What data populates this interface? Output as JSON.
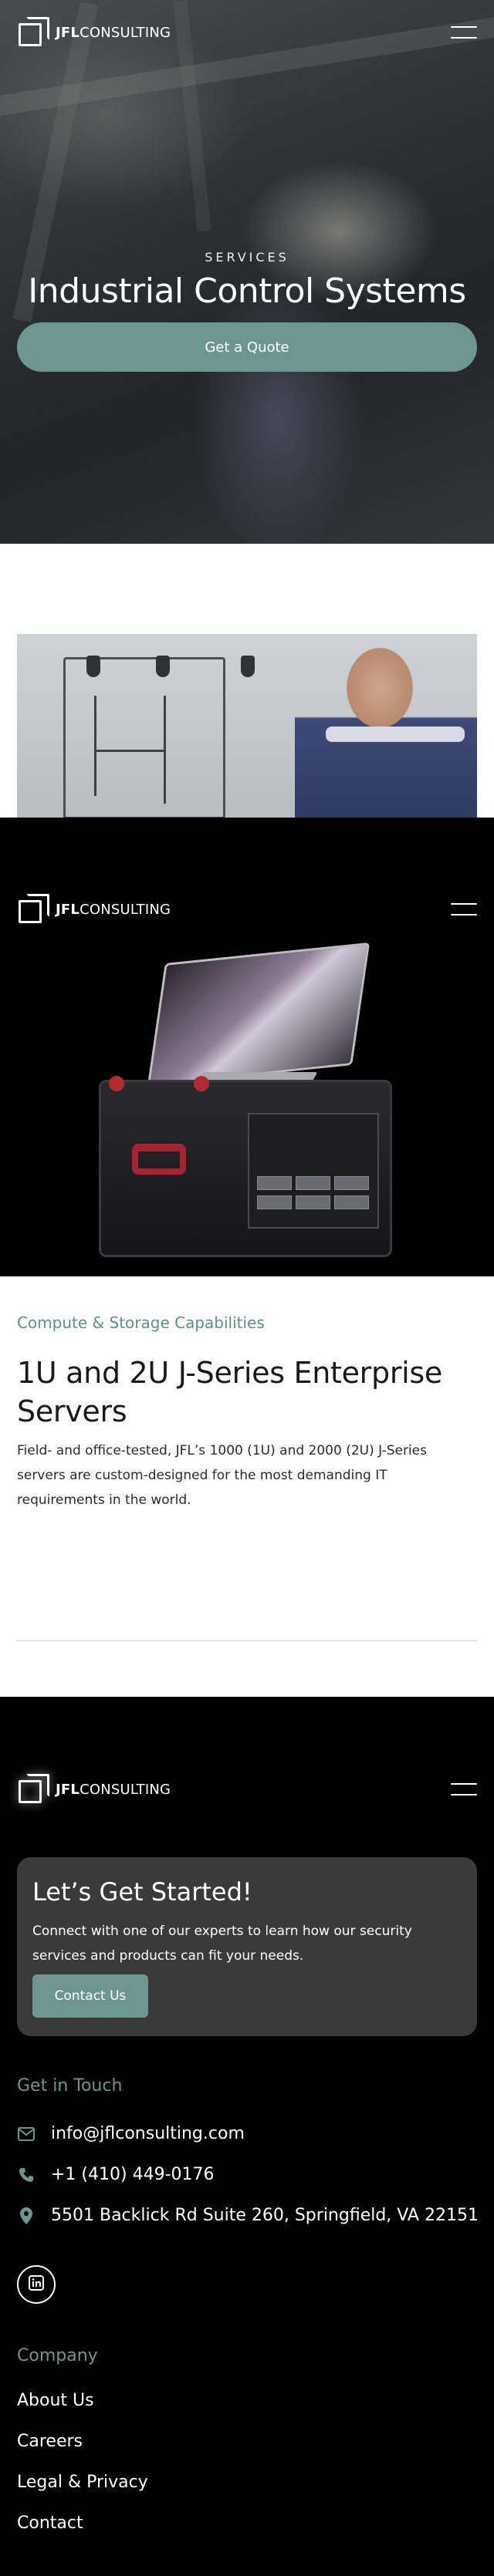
{
  "brand": {
    "logo_bold": "JFL",
    "logo_light": "CONSULTING"
  },
  "hero": {
    "eyebrow": "SERVICES",
    "title": "Industrial Control Systems",
    "cta_label": "Get a Quote"
  },
  "servers": {
    "eyebrow": "Compute & Storage Capabilities",
    "title": "1U and 2U J-Series Enterprise Servers",
    "description": "Field- and office-tested, JFL’s 1000 (1U) and 2000 (2U) J-Series servers are custom-designed for the most demanding IT requirements in the world."
  },
  "footer": {
    "cta": {
      "title": "Let’s Get Started!",
      "description": "Connect with one of our experts to learn how our security services and products can fit your needs.",
      "button_label": "Contact Us"
    },
    "get_in_touch_label": "Get in Touch",
    "contact": {
      "email": "info@jflconsulting.com",
      "phone": "+1 (410) 449-0176",
      "address": "5501 Backlick Rd Suite 260, Springfield, VA 22151"
    },
    "social": {
      "icon": "linkedin-icon"
    },
    "company_label": "Company",
    "company_links": [
      "About Us",
      "Careers",
      "Legal & Privacy",
      "Contact"
    ]
  },
  "colors": {
    "accent": "#6e9690",
    "footer_bg": "#000000",
    "cta_card_bg": "#3a3a3a"
  }
}
